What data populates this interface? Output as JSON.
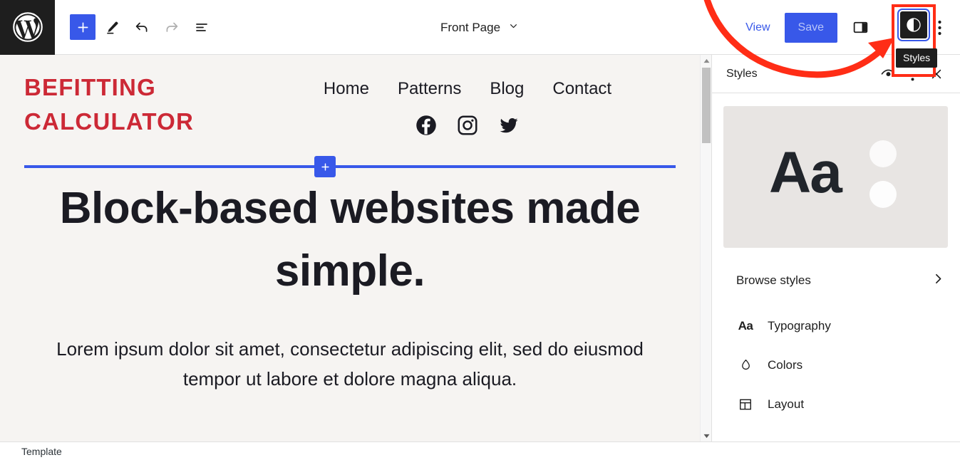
{
  "toolbar": {
    "logo_icon": "wordpress-logo-icon",
    "add_block_label": "+",
    "tools_icon": "pencil-edit-icon",
    "undo_icon": "undo-arrow-icon",
    "redo_icon": "redo-arrow-icon",
    "list_view_icon": "list-view-icon",
    "document_title": "Front Page",
    "document_chevron_icon": "chevron-down-icon",
    "view_label": "View",
    "save_label": "Save",
    "sidebar_toggle_icon": "sidebar-panel-icon",
    "styles_icon": "contrast-half-circle-icon",
    "styles_tooltip": "Styles",
    "options_icon": "ellipsis-vertical-icon"
  },
  "annotation": {
    "arrow_color": "#ff2d16",
    "highlight_color": "#ff2d16",
    "focus_ring_color": "#3858e9"
  },
  "canvas": {
    "background": "#f6f4f2",
    "site_title": "BEFITTING CALCULATOR",
    "site_title_color": "#cc2936",
    "nav_items": [
      "Home",
      "Patterns",
      "Blog",
      "Contact"
    ],
    "social_icons": [
      "facebook-icon",
      "instagram-icon",
      "twitter-icon"
    ],
    "separator_color": "#3858e9",
    "inserter_label": "+",
    "heading": "Block-based websites made simple.",
    "paragraph": "Lorem ipsum dolor sit amet, consectetur adipiscing elit, sed do eiusmod tempor ut labore et dolore magna aliqua."
  },
  "scrollbar": {
    "up_icon": "scroll-up-arrow-icon",
    "down_icon": "scroll-down-arrow-icon"
  },
  "styles_panel": {
    "title": "Styles",
    "preview_icon": "eye-preview-icon",
    "more_icon": "ellipsis-vertical-icon",
    "close_icon": "close-x-icon",
    "preview_card": {
      "sample_text": "Aa",
      "background": "#e8e5e3",
      "text_color": "#21252b"
    },
    "browse_styles_label": "Browse styles",
    "browse_chevron_icon": "chevron-right-icon",
    "menu": [
      {
        "label": "Typography",
        "icon": "aa-typography-icon",
        "glyph": "Aa"
      },
      {
        "label": "Colors",
        "icon": "color-drop-icon"
      },
      {
        "label": "Layout",
        "icon": "layout-grid-icon"
      }
    ]
  },
  "bottom_bar": {
    "label": "Template"
  }
}
